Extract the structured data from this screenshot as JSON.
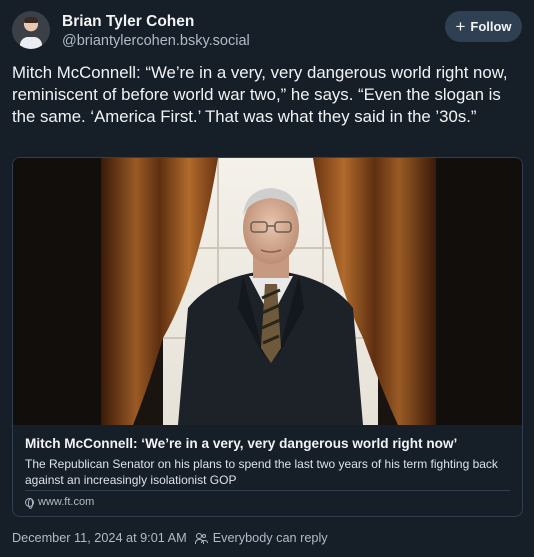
{
  "author": {
    "name": "Brian Tyler Cohen",
    "handle": "@briantylercohen.bsky.social"
  },
  "follow_button": {
    "icon": "plus-icon",
    "label": "Follow"
  },
  "post": {
    "text": "Mitch McConnell: “We’re in a very, very dangerous world right now, reminiscent of before world war two,” he says. “Even the slogan is the same. ‘America First.’ That was what they said in the ’30s.”"
  },
  "link_card": {
    "title": "Mitch McConnell: ‘We’re in a very, very dangerous world right now’",
    "description": "The Republican Senator on his plans to spend the last two years of his term fighting back against an increasingly isolationist GOP",
    "domain": "www.ft.com",
    "domain_icon": "globe-icon"
  },
  "footer": {
    "timestamp": "December 11, 2024 at 9:01 AM",
    "reply_setting": "Everybody can reply",
    "reply_icon": "people-icon"
  },
  "colors": {
    "background": "#161e27",
    "border": "#2e4052",
    "secondary_text": "#aebbc9",
    "button_bg": "#2e4052"
  }
}
